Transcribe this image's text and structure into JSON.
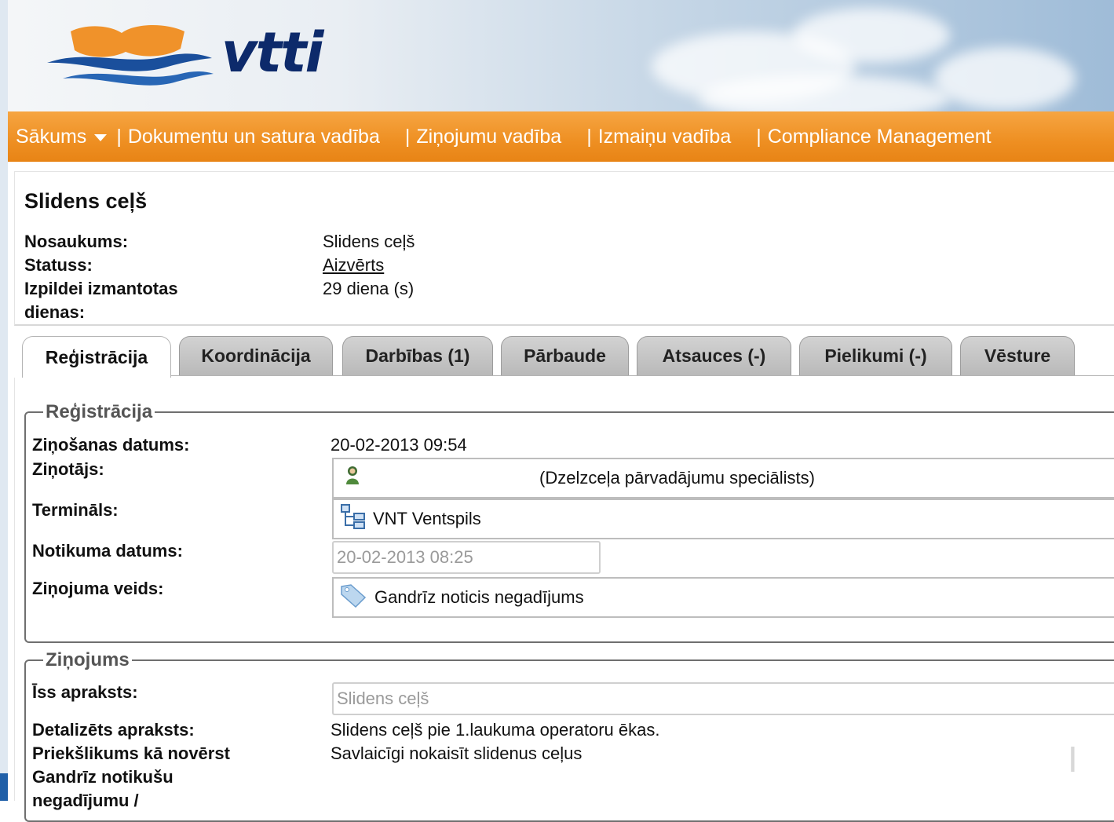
{
  "brand": {
    "logo_text": "vtti",
    "colors": {
      "navy": "#0d2a6b",
      "orange": "#ee8f22",
      "wave_blue": "#1a4f9c"
    }
  },
  "nav": {
    "items": [
      {
        "label": "Sākums",
        "has_dropdown": true
      },
      {
        "label": "Dokumentu un satura vadība"
      },
      {
        "label": "Ziņojumu vadība"
      },
      {
        "label": "Izmaiņu vadība"
      },
      {
        "label": "Compliance Management"
      }
    ],
    "separator": "|"
  },
  "record": {
    "title": "Slidens ceļš",
    "fields": [
      {
        "label": "Nosaukums:",
        "value": "Slidens ceļš"
      },
      {
        "label": "Statuss:",
        "value": "Aizvērts"
      },
      {
        "label": "Izpildei izmantotas dienas:",
        "value": "29 diena (s)"
      }
    ]
  },
  "tabs": [
    {
      "label": "Reģistrācija",
      "active": true
    },
    {
      "label": "Koordinācija"
    },
    {
      "label": "Darbības (1)"
    },
    {
      "label": "Pārbaude"
    },
    {
      "label": "Atsauces (-)"
    },
    {
      "label": "Pielikumi (-)"
    },
    {
      "label": "Vēsture"
    }
  ],
  "registration": {
    "legend": "Reģistrācija",
    "report_date_label": "Ziņošanas datums:",
    "report_date": "20-02-2013 09:54",
    "reporter_label": "Ziņotājs:",
    "reporter": "(Dzelzceļa pārvadājumu speciālists)",
    "reporter_icon": "user-icon",
    "terminal_label": "Termināls:",
    "terminal": "VNT Ventspils",
    "terminal_icon": "org-tree-icon",
    "event_date_label": "Notikuma datums:",
    "event_date": "20-02-2013 08:25",
    "report_type_label": "Ziņojuma veids:",
    "report_type": "Gandrīz noticis negadījums",
    "report_type_icon": "tag-icon"
  },
  "report": {
    "legend": "Ziņojums",
    "short_desc_label": "Īss apraksts:",
    "short_desc": "Slidens ceļš",
    "detail_label": "Detalizēts apraksts:",
    "detail": "Slidens ceļš pie 1.laukuma operatoru ēkas.",
    "proposal_label": "Priekšlikums kā novērst Gandrīz notikušu negadījumu /",
    "proposal": "Savlaicīgi nokaisīt slidenus ceļus"
  }
}
